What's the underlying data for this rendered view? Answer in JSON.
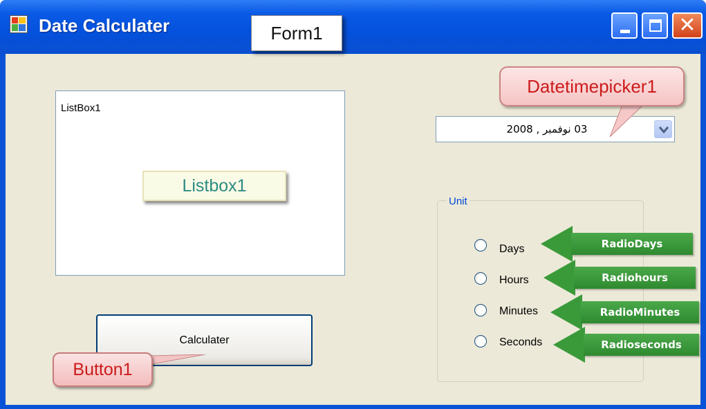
{
  "window": {
    "title": "Date Calculater"
  },
  "annotations": {
    "form": "Form1",
    "listbox": "Listbox1",
    "button": "Button1",
    "datetimepicker": "Datetimepicker1",
    "radio_days": "RadioDays",
    "radio_hours": "Radiohours",
    "radio_minutes": "RadioMinutes",
    "radio_seconds": "Radioseconds"
  },
  "listbox": {
    "item": "ListBox1"
  },
  "button": {
    "label": "Calculater"
  },
  "datetimepicker": {
    "value": "03   نوفمبر , 2008"
  },
  "unit_group": {
    "label": "Unit",
    "options": [
      "Days",
      "Hours",
      "Minutes",
      "Seconds"
    ]
  },
  "colors": {
    "titlebar": "#0a5ae6",
    "client": "#ece9d8",
    "callout_red": "#cc1b1b",
    "arrow_green": "#3a9a3a"
  }
}
